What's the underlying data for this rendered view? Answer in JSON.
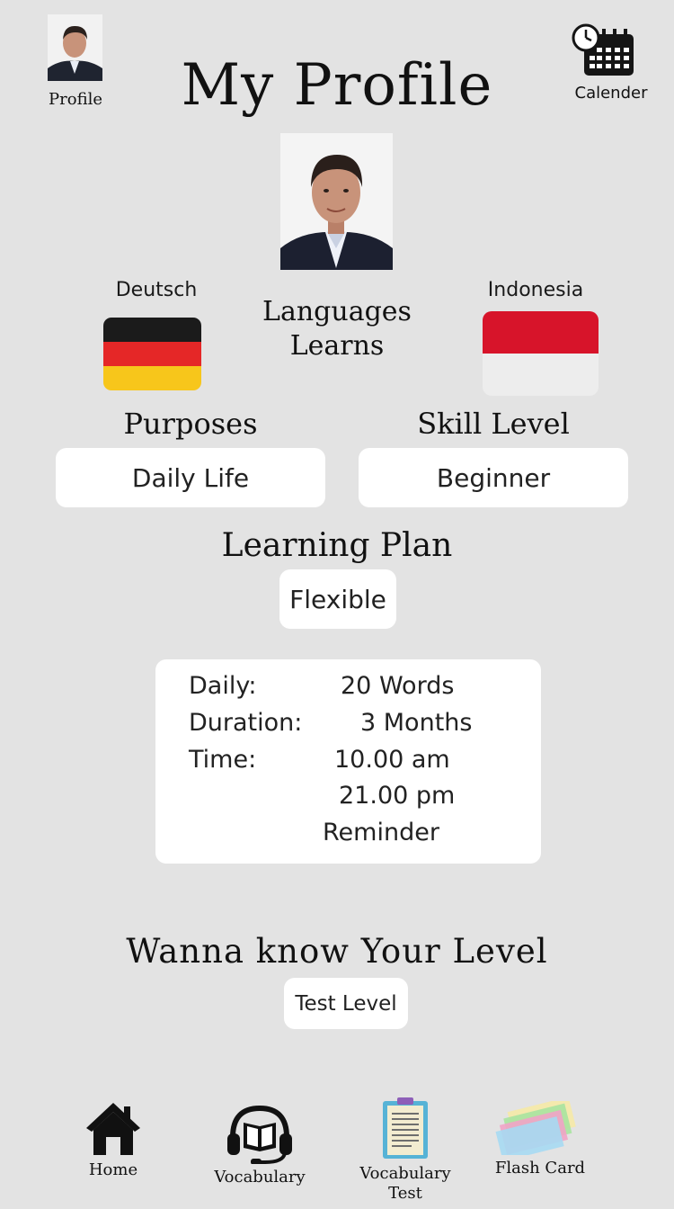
{
  "header": {
    "profile_label": "Profile",
    "title": "My Profile",
    "calendar_label": "Calender"
  },
  "languages": {
    "from_label": "Deutsch",
    "to_label": "Indonesia",
    "title_line1": "Languages",
    "title_line2": "Learns",
    "from_flag_colors": [
      "#1b1b1b",
      "#e52727",
      "#f7c61b"
    ],
    "to_flag_colors": [
      "#d7142a",
      "#ededed"
    ]
  },
  "purposes": {
    "title": "Purposes",
    "value": "Daily Life"
  },
  "skill": {
    "title": "Skill Level",
    "value": "Beginner"
  },
  "learning_plan": {
    "title": "Learning Plan",
    "value": "Flexible",
    "daily_label": "Daily:",
    "daily_value": "20 Words",
    "duration_label": "Duration:",
    "duration_value": "3 Months",
    "time_label": "Time:",
    "time_value_1": "10.00 am",
    "time_value_2": "21.00 pm",
    "reminder": "Reminder"
  },
  "level_test": {
    "title": "Wanna know Your Level",
    "button": "Test Level"
  },
  "nav": {
    "home": "Home",
    "vocabulary": "Vocabulary",
    "vocab_test_line1": "Vocabulary",
    "vocab_test_line2": "Test",
    "flash_card": "Flash Card"
  }
}
